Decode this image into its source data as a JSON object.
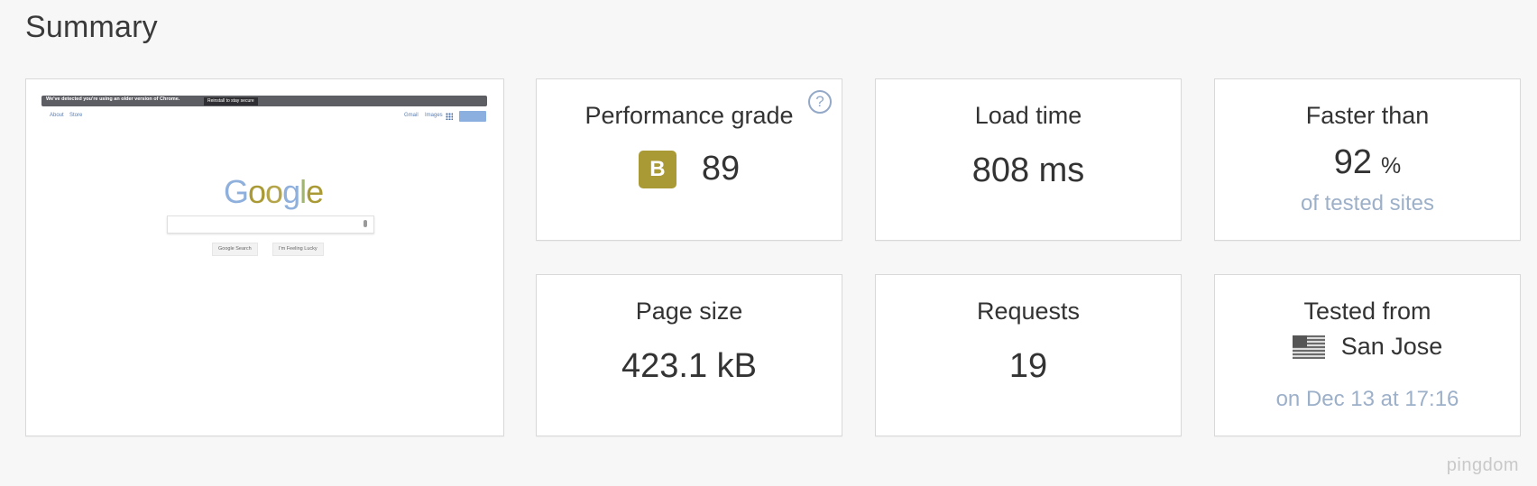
{
  "page_title": "Summary",
  "thumbnail": {
    "banner_text": "We've detected you're using an older version of Chrome.",
    "banner_button": "Reinstall to stay secure",
    "nav_left": [
      "About",
      "Store"
    ],
    "nav_right": [
      "Gmail",
      "Images"
    ],
    "logo_letters": [
      "G",
      "o",
      "o",
      "g",
      "l",
      "e"
    ],
    "buttons": [
      "Google Search",
      "I'm Feeling Lucky"
    ]
  },
  "performance": {
    "label": "Performance grade",
    "grade": "B",
    "score": "89",
    "help": "?",
    "grade_color": "#a99a35"
  },
  "load_time": {
    "label": "Load time",
    "value": "808 ms"
  },
  "faster_than": {
    "label": "Faster than",
    "value": "92",
    "unit": "%",
    "sub": "of tested sites"
  },
  "page_size": {
    "label": "Page size",
    "value": "423.1 kB"
  },
  "requests": {
    "label": "Requests",
    "value": "19"
  },
  "tested_from": {
    "label": "Tested from",
    "location": "San Jose",
    "flag": "us-flag-icon",
    "sub": "on Dec 13 at 17:16"
  },
  "brand": "pingdom",
  "colors": {
    "accent_text": "#9db0c9",
    "help_icon": "#93a9c7"
  }
}
